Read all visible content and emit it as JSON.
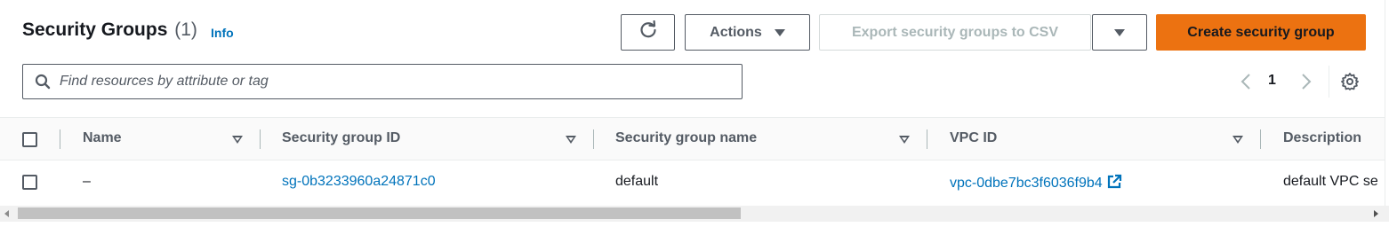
{
  "header": {
    "title": "Security Groups",
    "count": "(1)",
    "info_label": "Info"
  },
  "toolbar": {
    "refresh_icon": "refresh-icon",
    "actions_label": "Actions",
    "export_label": "Export security groups to CSV",
    "create_label": "Create security group"
  },
  "search": {
    "placeholder": "Find resources by attribute or tag",
    "value": ""
  },
  "pagination": {
    "current_page": "1"
  },
  "table": {
    "columns": [
      "Name",
      "Security group ID",
      "Security group name",
      "VPC ID",
      "Description"
    ],
    "rows": [
      {
        "name": "–",
        "security_group_id": "sg-0b3233960a24871c0",
        "security_group_name": "default",
        "vpc_id": "vpc-0dbe7bc3f6036f9b4",
        "description": "default VPC se"
      }
    ]
  },
  "colors": {
    "primary": "#ec7211",
    "link": "#0073bb",
    "text": "#16191f",
    "muted": "#545b64",
    "disabled": "#aab7b8"
  }
}
